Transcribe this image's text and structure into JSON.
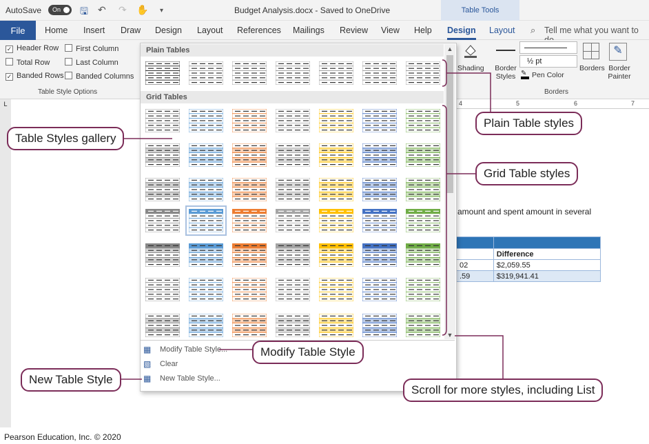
{
  "titlebar": {
    "autosave_label": "AutoSave",
    "autosave_state": "On",
    "doc_title": "Budget Analysis.docx  -  Saved to OneDrive",
    "contextual_tab": "Table Tools"
  },
  "tabs": [
    "File",
    "Home",
    "Insert",
    "Draw",
    "Design",
    "Layout",
    "References",
    "Mailings",
    "Review",
    "View",
    "Help",
    "Design",
    "Layout"
  ],
  "tell_me": "Tell me what you want to do",
  "style_options": {
    "items": [
      {
        "label": "Header Row",
        "checked": true
      },
      {
        "label": "First Column",
        "checked": false
      },
      {
        "label": "Total Row",
        "checked": false
      },
      {
        "label": "Last Column",
        "checked": false
      },
      {
        "label": "Banded Rows",
        "checked": true
      },
      {
        "label": "Banded Columns",
        "checked": false
      }
    ],
    "group_label": "Table Style Options"
  },
  "borders_group": {
    "shading": "Shading",
    "border_styles": "Border Styles",
    "weight": "½ pt",
    "pen_color": "Pen Color",
    "borders": "Borders",
    "border_painter": "Border Painter",
    "group_label": "Borders"
  },
  "ruler": {
    "marks": [
      "4",
      "5",
      "6",
      "7"
    ]
  },
  "gallery": {
    "plain_header": "Plain Tables",
    "grid_header": "Grid Tables",
    "grid_colors": [
      "#888888",
      "#5b9bd5",
      "#ed7d31",
      "#a5a5a5",
      "#ffc000",
      "#4472c4",
      "#70ad47"
    ],
    "menu": [
      "Modify Table Style...",
      "Clear",
      "New Table Style..."
    ]
  },
  "document": {
    "text": "amount and spent amount in several",
    "table": {
      "header": [
        "",
        "Difference"
      ],
      "rows": [
        [
          "02",
          "$2,059.55"
        ],
        [
          ".59",
          "$319,941.41"
        ]
      ]
    }
  },
  "callouts": {
    "table_styles_gallery": "Table Styles gallery",
    "plain_table_styles": "Plain Table styles",
    "grid_table_styles": "Grid Table styles",
    "modify_table_style": "Modify Table Style",
    "new_table_style": "New Table Style",
    "scroll_more": "Scroll for more styles, including List"
  },
  "footer": "Pearson Education, Inc. © 2020"
}
